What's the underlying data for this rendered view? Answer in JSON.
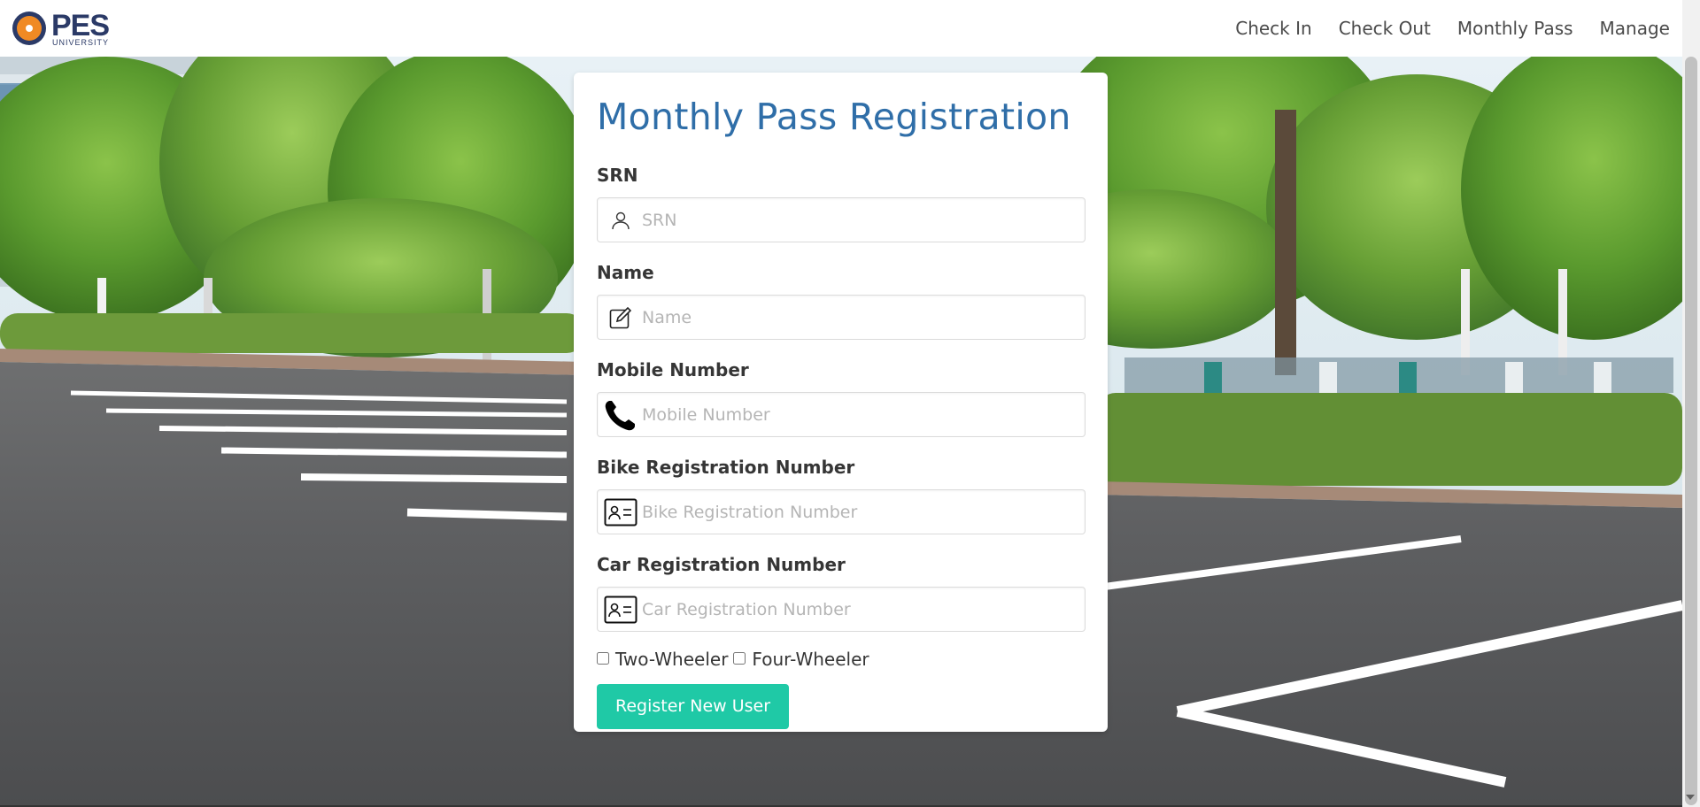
{
  "brand": {
    "logo_text": "PES",
    "logo_subtext": "UNIVERSITY"
  },
  "nav": {
    "items": [
      {
        "label": "Check In"
      },
      {
        "label": "Check Out"
      },
      {
        "label": "Monthly Pass"
      },
      {
        "label": "Manage"
      }
    ]
  },
  "form": {
    "title": "Monthly Pass Registration",
    "fields": [
      {
        "label": "SRN",
        "placeholder": "SRN",
        "icon": "user-icon"
      },
      {
        "label": "Name",
        "placeholder": "Name",
        "icon": "edit-icon"
      },
      {
        "label": "Mobile Number",
        "placeholder": "Mobile Number",
        "icon": "phone-icon"
      },
      {
        "label": "Bike Registration Number",
        "placeholder": "Bike Registration Number",
        "icon": "id-card-icon"
      },
      {
        "label": "Car Registration Number",
        "placeholder": "Car Registration Number",
        "icon": "id-card-icon"
      }
    ],
    "checkboxes": [
      {
        "label": "Two-Wheeler",
        "checked": false
      },
      {
        "label": "Four-Wheeler",
        "checked": false
      }
    ],
    "submit_label": "Register New User"
  },
  "colors": {
    "title": "#2f6ea8",
    "button": "#1fc9a6",
    "brand_navy": "#2b3a67",
    "brand_orange": "#f08a24"
  }
}
